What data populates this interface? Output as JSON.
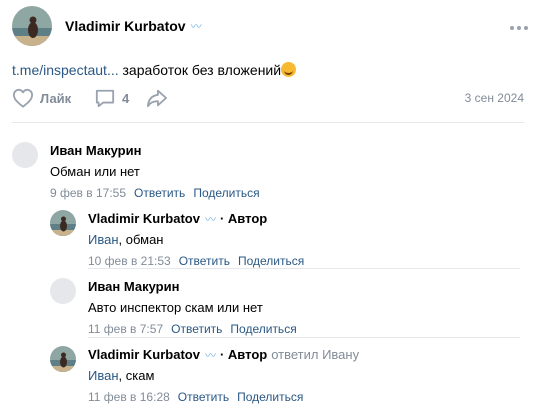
{
  "post": {
    "author": "Vladimir Kurbatov",
    "author_badge": "〰",
    "text_link": "t.me/inspectaut...",
    "text_rest": " заработок без вложений",
    "emoji": "smiling-face-with-hearts",
    "like_label": "Лайк",
    "comment_count": "4",
    "date": "3 сен 2024"
  },
  "comments": [
    {
      "author": "Иван Макурин",
      "author_tag": "",
      "reply_note": "",
      "mention": "",
      "text": "Обман или нет",
      "time": "9 фев в 17:55",
      "reply_label": "Ответить",
      "share_label": "Поделиться"
    },
    {
      "author": "Vladimir Kurbatov",
      "author_badge": "〰",
      "author_tag": "· Автор",
      "reply_note": "",
      "mention": "Иван",
      "text": ", обман",
      "time": "10 фев в 21:53",
      "reply_label": "Ответить",
      "share_label": "Поделиться"
    },
    {
      "author": "Иван Макурин",
      "author_tag": "",
      "reply_note": "",
      "mention": "",
      "text": "Авто инспектор скам или нет",
      "time": "11 фев в 7:57",
      "reply_label": "Ответить",
      "share_label": "Поделиться"
    },
    {
      "author": "Vladimir Kurbatov",
      "author_badge": "〰",
      "author_tag": "· Автор",
      "reply_note": "ответил Ивану",
      "mention": "Иван",
      "text": ", скам",
      "time": "11 фев в 16:28",
      "reply_label": "Ответить",
      "share_label": "Поделиться"
    }
  ],
  "colors": {
    "link": "#2a5885",
    "secondary": "#818c99",
    "divider": "#e7e8ec",
    "badge": "#6ab0e8"
  }
}
